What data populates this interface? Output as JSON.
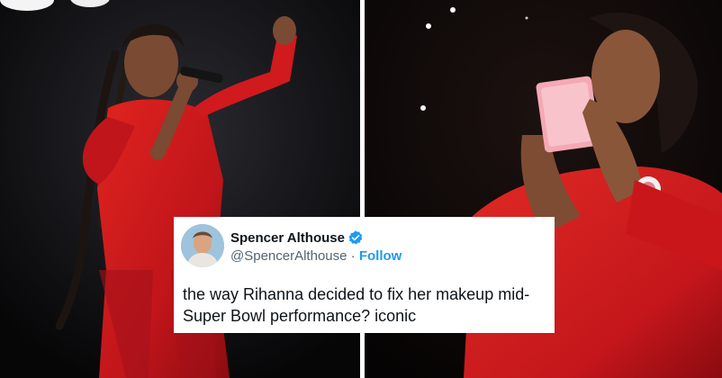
{
  "tweet": {
    "display_name": "Spencer Althouse",
    "handle": "@SpencerAlthouse",
    "separator": " · ",
    "follow_label": "Follow",
    "text": "the way Rihanna decided to fix her makeup mid-Super Bowl performance? iconic"
  },
  "colors": {
    "outfit_red": "#d3161c",
    "follow_blue": "#1d9bf0",
    "compact_pink": "#f4a9b4"
  },
  "icons": {
    "verified": "verified-badge-icon"
  }
}
